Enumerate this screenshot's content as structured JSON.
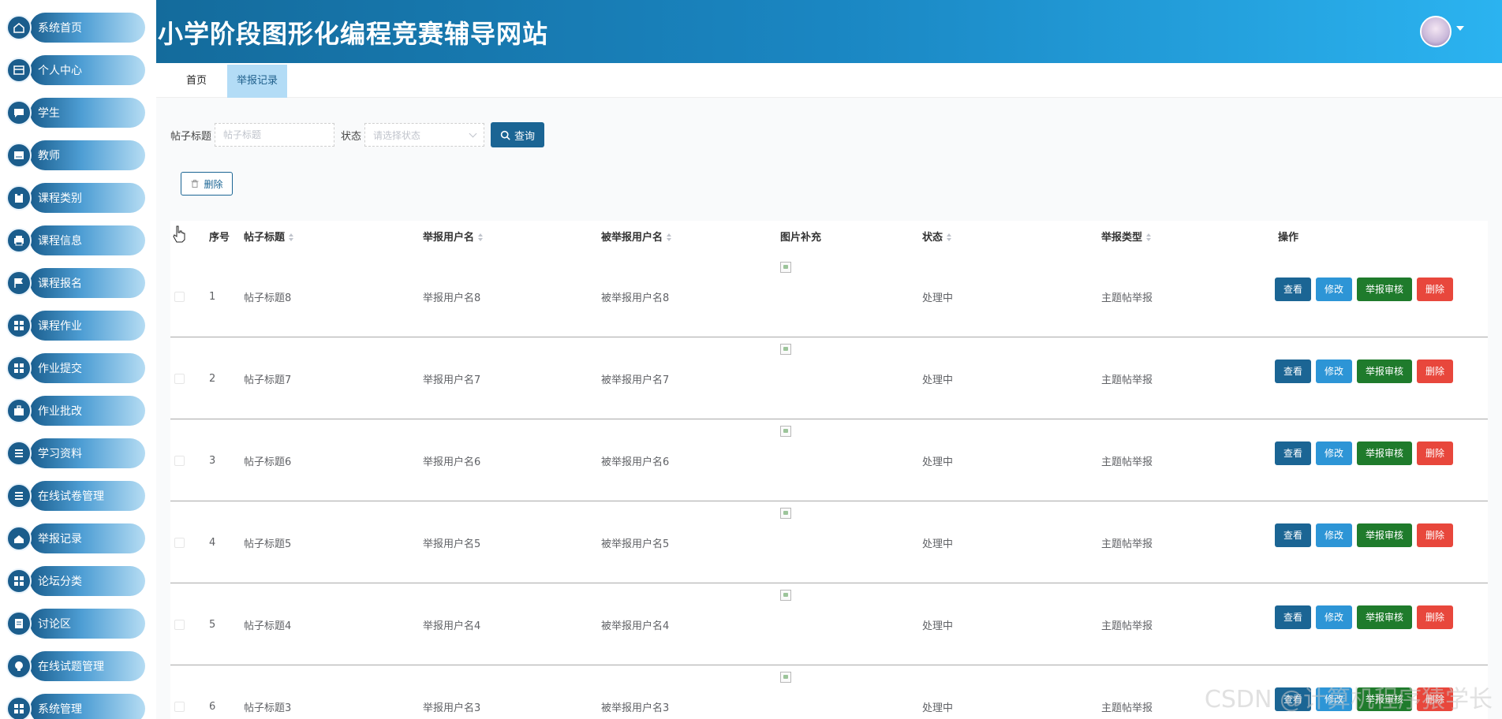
{
  "app": {
    "title": "小学阶段图形化编程竞赛辅导网站"
  },
  "colors": {
    "primary": "#1b6594",
    "header_gradient_end": "#2bb3f0",
    "active_tab": "#b3dcf6",
    "edit": "#2d95d6",
    "audit": "#1f7b2c",
    "delete": "#e8473c"
  },
  "sidebar": {
    "items": [
      {
        "label": "系统首页",
        "icon": "home-icon"
      },
      {
        "label": "个人中心",
        "icon": "card-icon"
      },
      {
        "label": "学生",
        "icon": "chat-icon"
      },
      {
        "label": "教师",
        "icon": "board-icon"
      },
      {
        "label": "课程类别",
        "icon": "clipboard-icon"
      },
      {
        "label": "课程信息",
        "icon": "printer-icon"
      },
      {
        "label": "课程报名",
        "icon": "flag-icon"
      },
      {
        "label": "课程作业",
        "icon": "grid-icon"
      },
      {
        "label": "作业提交",
        "icon": "grid-icon"
      },
      {
        "label": "作业批改",
        "icon": "briefcase-icon"
      },
      {
        "label": "学习资料",
        "icon": "list-icon"
      },
      {
        "label": "在线试卷管理",
        "icon": "list-icon"
      },
      {
        "label": "举报记录",
        "icon": "house-icon"
      },
      {
        "label": "论坛分类",
        "icon": "grid-icon"
      },
      {
        "label": "讨论区",
        "icon": "document-icon"
      },
      {
        "label": "在线试题管理",
        "icon": "bulb-icon"
      },
      {
        "label": "系统管理",
        "icon": "grid-icon"
      }
    ]
  },
  "tabs": [
    {
      "label": "首页",
      "active": false
    },
    {
      "label": "举报记录",
      "active": true
    }
  ],
  "search": {
    "title_label": "帖子标题",
    "title_placeholder": "帖子标题",
    "status_label": "状态",
    "status_placeholder": "请选择状态",
    "query_button": "查询"
  },
  "toolbar": {
    "delete_label": "删除"
  },
  "table": {
    "headers": {
      "index": "序号",
      "post_title": "帖子标题",
      "reporter": "举报用户名",
      "reported": "被举报用户名",
      "image": "图片补充",
      "status": "状态",
      "report_type": "举报类型",
      "actions": "操作"
    },
    "rows": [
      {
        "index": "1",
        "post_title": "帖子标题8",
        "reporter": "举报用户名8",
        "reported": "被举报用户名8",
        "status": "处理中",
        "report_type": "主题帖举报"
      },
      {
        "index": "2",
        "post_title": "帖子标题7",
        "reporter": "举报用户名7",
        "reported": "被举报用户名7",
        "status": "处理中",
        "report_type": "主题帖举报"
      },
      {
        "index": "3",
        "post_title": "帖子标题6",
        "reporter": "举报用户名6",
        "reported": "被举报用户名6",
        "status": "处理中",
        "report_type": "主题帖举报"
      },
      {
        "index": "4",
        "post_title": "帖子标题5",
        "reporter": "举报用户名5",
        "reported": "被举报用户名5",
        "status": "处理中",
        "report_type": "主题帖举报"
      },
      {
        "index": "5",
        "post_title": "帖子标题4",
        "reporter": "举报用户名4",
        "reported": "被举报用户名4",
        "status": "处理中",
        "report_type": "主题帖举报"
      },
      {
        "index": "6",
        "post_title": "帖子标题3",
        "reporter": "举报用户名3",
        "reported": "被举报用户名3",
        "status": "处理中",
        "report_type": "主题帖举报"
      }
    ],
    "actions": {
      "view": "查看",
      "edit": "修改",
      "audit": "举报审核",
      "delete": "删除"
    }
  },
  "watermark": "CSDN @计算机程序猿学长"
}
